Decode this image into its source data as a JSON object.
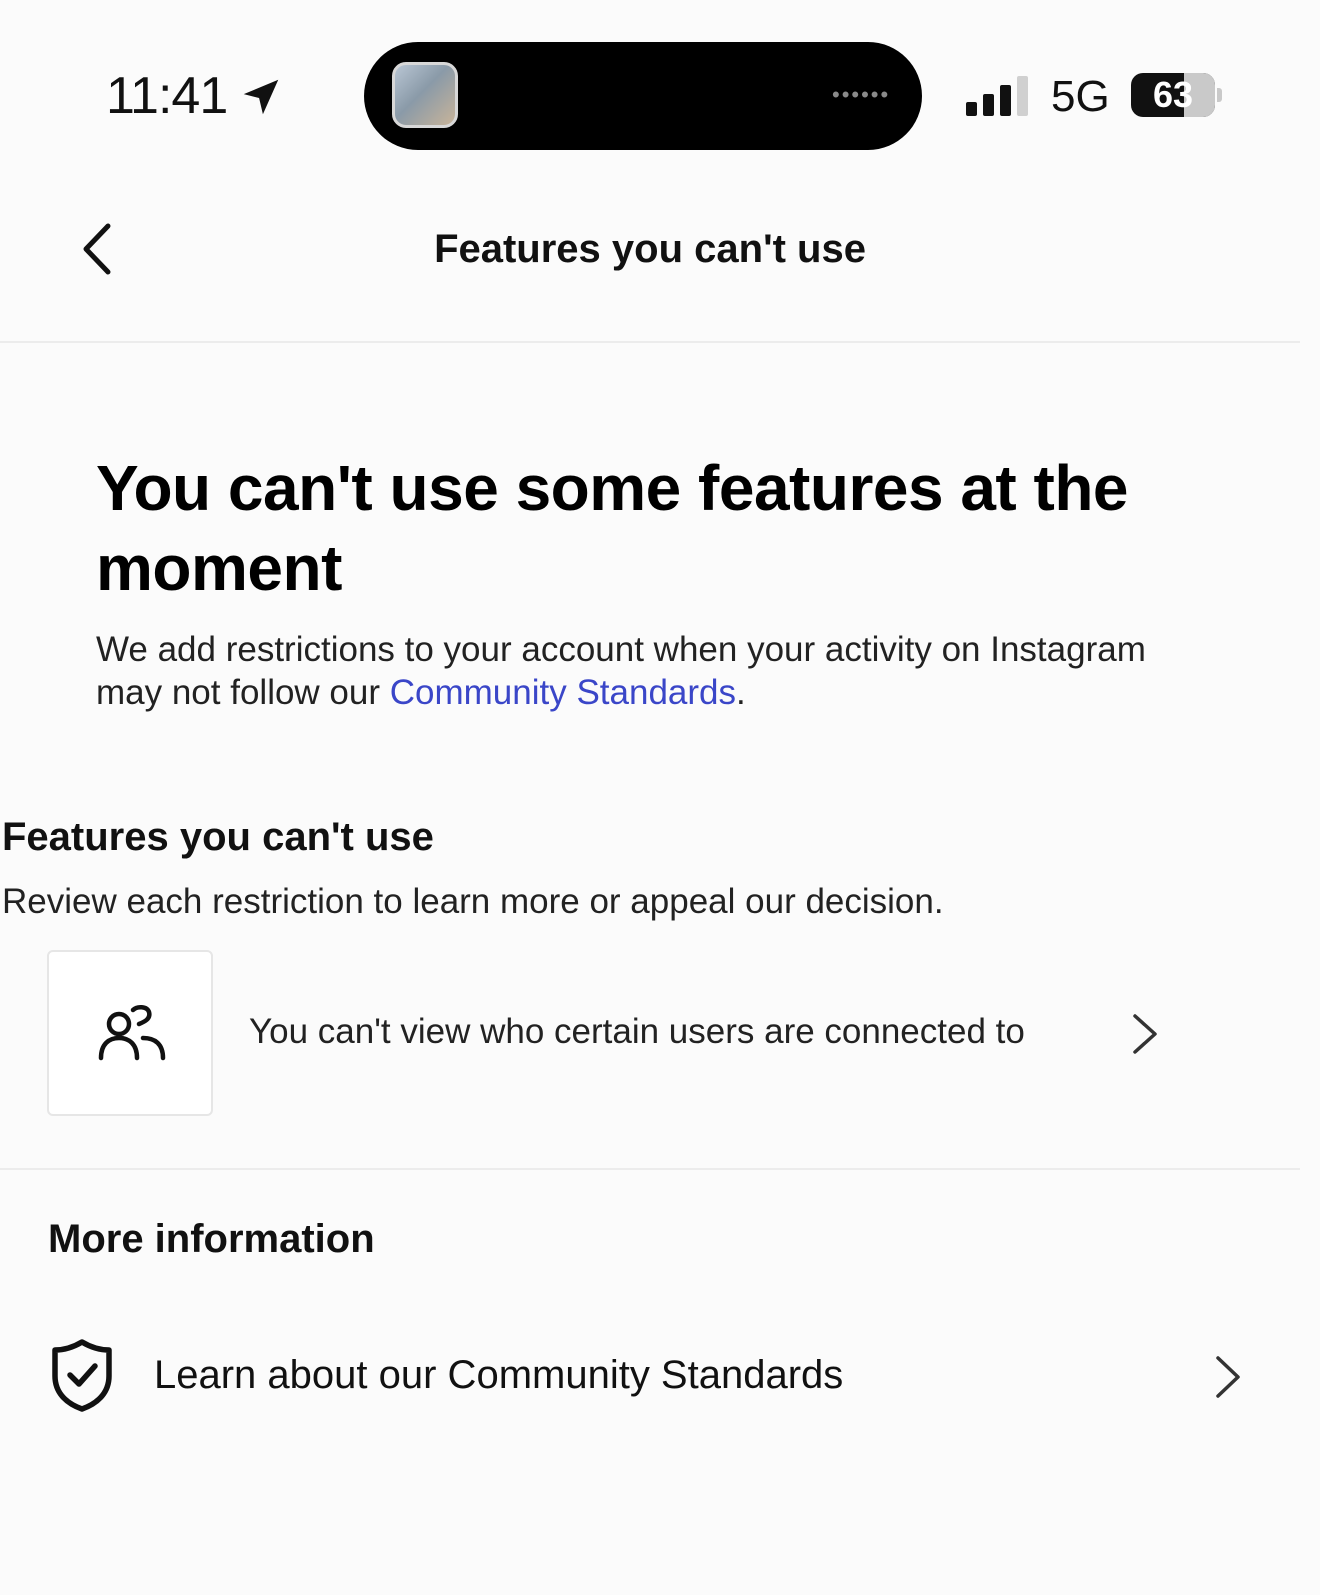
{
  "status_bar": {
    "time": "11:41",
    "location_icon": "location-arrow-icon",
    "network": "5G",
    "battery_level": "63",
    "battery_fraction": 0.63,
    "signal_bars_active": 3,
    "signal_bars_total": 4
  },
  "header": {
    "back_icon": "chevron-left-icon",
    "title": "Features you can't use"
  },
  "hero": {
    "title": "You can't use some features at the moment",
    "description_prefix": "We add restrictions to your account when your activity on Instagram may not follow our ",
    "description_link": "Community Standards",
    "description_suffix": "."
  },
  "features_section": {
    "title": "Features you can't use",
    "subtitle": "Review each restriction to learn more or appeal our decision.",
    "items": [
      {
        "icon": "users-icon",
        "label": "You can't view who certain users are connected to"
      }
    ]
  },
  "more_info": {
    "title": "More information",
    "items": [
      {
        "icon": "shield-check-icon",
        "label": "Learn about our Community Standards"
      }
    ]
  },
  "colors": {
    "link": "#3a46c8",
    "background": "#fbfbfb",
    "text": "#111111"
  }
}
